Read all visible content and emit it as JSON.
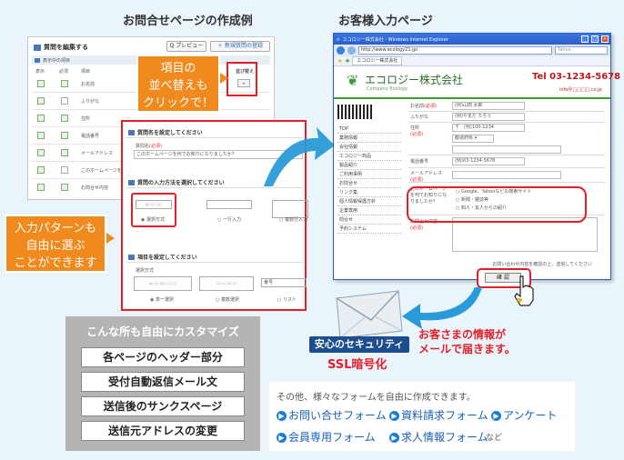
{
  "headings": {
    "left": "お問合せページの作成例",
    "right": "お客様入力ページ"
  },
  "editor": {
    "title": "質問を編集する",
    "preview_btn": "Q プレビュー",
    "add_btn": "＋ 新規質問の登録",
    "subheader": "表示中の項目",
    "col_show": "表示",
    "col_required": "必須",
    "col_item": "項目",
    "col_sort": "並び替え",
    "rows": [
      "お名前",
      "ふりがな",
      "住所",
      "電話番号",
      "メールアドレス",
      "このホームページを…",
      "お問合せ内容"
    ]
  },
  "callout_sort": {
    "line1": "項目の",
    "line2": "並べ替えも",
    "line3": "クリックで！"
  },
  "settings": {
    "sec1_title": "質問名を設定してください",
    "sec1_label": "質問名",
    "sec1_required": "(必須)",
    "sec1_value": "このホームページを何でお知りになりましたか？",
    "sec2_title": "質問の入力方法を選択してください",
    "sec2_opt1": "選択方式",
    "sec2_opt2": "一行入力",
    "sec2_opt3": "複数行入力",
    "sec3_title": "項目を設定してください",
    "sec3_label": "選択方式",
    "sec3_opt1": "単一選択",
    "sec3_opt2": "複数選択",
    "sec3_opt3": "リスト",
    "sec3_field": "番号"
  },
  "callout_input": {
    "line1": "入力パターンも",
    "line2": "自由に選ぶ",
    "line3": "ことができます"
  },
  "browser": {
    "title_bar": "エコロジー株式会社 - Windows Internet Explorer",
    "url": "http://www.ecology21.jp/",
    "tab": "エコロジー株式会社",
    "search_placeholder": "Yahoo",
    "company_name": "エコロジー株式会社",
    "company_sub": "Company Ecology",
    "tel": "Tel 03-1234-5678",
    "email": "info＠□□□□.co.jp",
    "nav": [
      "TOP",
      "業務情報",
      "会社情報",
      "エコロジー商品",
      "製品紹介",
      "ご利用事例",
      "お問合せ",
      "リンク集",
      "個人情報保護方針",
      "企業専用",
      "問合せ",
      "予約システム"
    ],
    "form_labels": [
      "お名前",
      "ふりがな",
      "住所",
      "",
      "電話番号",
      "メールアドレス",
      "このホームページを何でお知りになりましたか？",
      "お問合せ内容"
    ],
    "form_required": "(必須)",
    "form_values": [
      "(例)山田 太郎",
      "(例)やまだ たろう",
      "〒　(例)100-1234",
      "都道府県",
      "(例)03-1234-5678",
      "",
      "",
      ""
    ],
    "radio_options": [
      "Google、Yahooなどの検索サイト",
      "新聞・雑誌等",
      "知人・友人からの紹介"
    ],
    "confirm_note": "お問い合わせ内容を確認の上、送信してください",
    "confirm_btn": "確 認"
  },
  "ssl": {
    "badge": "安心のセキュリティ",
    "label": "SSL暗号化"
  },
  "mail_notice": {
    "line1": "お客さまの情報が",
    "line2": "メールで届きます。"
  },
  "customize": {
    "title": "こんな所も自由にカスタマイズ",
    "items": [
      "各ページのヘッダー部分",
      "受付自動返信メール文",
      "送信後のサンクスページ",
      "送信元アドレスの変更"
    ]
  },
  "forms": {
    "intro": "その他、様々なフォームを自由に作成できます。",
    "items": [
      "お問い合せフォーム",
      "資料請求フォーム",
      "アンケート",
      "会員専用フォーム",
      "求人情報フォーム"
    ],
    "etc": "など"
  },
  "colors": {
    "accent_orange": "#f08a1e",
    "alert_red": "#e51f2a",
    "link_blue": "#1a5fb4",
    "ie_title_blue": "#2a5fc9",
    "eco_green": "#3e9a3a",
    "panel_gray": "#b4b4b4"
  }
}
